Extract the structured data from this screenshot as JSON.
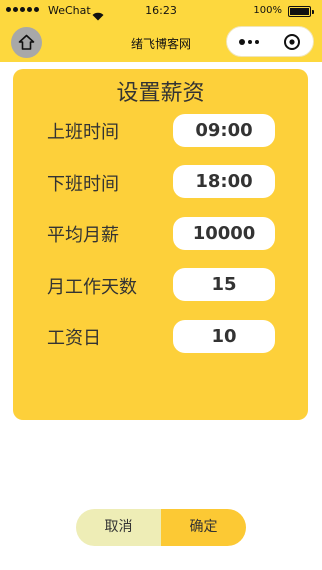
{
  "status_bar": {
    "carrier": "WeChat",
    "time": "16:23",
    "battery_percent": "100%",
    "battery_level": 1.0
  },
  "nav": {
    "title": "绪飞博客网",
    "home_icon": "home-icon",
    "more_icon": "more-dots-icon",
    "close_icon": "target-close-icon"
  },
  "form": {
    "title": "设置薪资",
    "fields": [
      {
        "label": "上班时间",
        "value": "09:00"
      },
      {
        "label": "下班时间",
        "value": "18:00"
      },
      {
        "label": "平均月薪",
        "value": "10000"
      },
      {
        "label": "月工作天数",
        "value": "15"
      },
      {
        "label": "工资日",
        "value": "10"
      }
    ]
  },
  "actions": {
    "cancel_label": "取消",
    "confirm_label": "确定"
  },
  "colors": {
    "header": "#fdd83e",
    "card": "#fdd03a",
    "cancel_bg": "#eeedb6",
    "confirm_bg": "#fcc934"
  }
}
